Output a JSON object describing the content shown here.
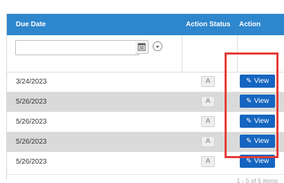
{
  "grid": {
    "columns": {
      "due_date": "Due Date",
      "action_status": "Action Status",
      "action": "Action"
    },
    "filter": {
      "due_date_value": "",
      "calendar_icon": "calendar-icon",
      "filter_icon": "filter-menu-icon"
    },
    "rows": [
      {
        "due_date": "3/24/2023",
        "status_icon_glyph": "A",
        "action_label": "View"
      },
      {
        "due_date": "5/26/2023",
        "status_icon_glyph": "A",
        "action_label": "View"
      },
      {
        "due_date": "5/26/2023",
        "status_icon_glyph": "A",
        "action_label": "View"
      },
      {
        "due_date": "5/26/2023",
        "status_icon_glyph": "A",
        "action_label": "View"
      },
      {
        "due_date": "5/26/2023",
        "status_icon_glyph": "A",
        "action_label": "View"
      }
    ],
    "pager": {
      "summary": "1 - 5 of 5 items"
    }
  },
  "colors": {
    "header_bg": "#2e86cc",
    "button_bg": "#1565c0",
    "alt_row_bg": "#dadada",
    "highlight": "#e53935"
  }
}
